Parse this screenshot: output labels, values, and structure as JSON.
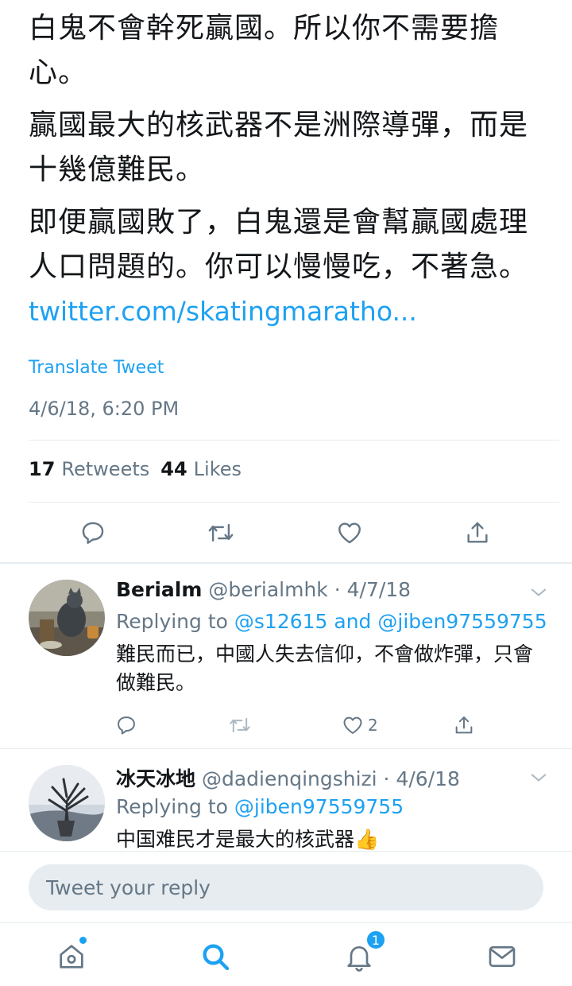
{
  "tweet": {
    "p1": "白鬼不會幹死贏國。所以你不需要擔心。",
    "p2": "贏國最大的核武器不是洲際導彈，而是十幾億難民。",
    "p3": "即便贏國敗了，白鬼還是會幫贏國處理人口問題的。你可以慢慢吃，不著急。",
    "link": "twitter.com/skatingmaratho...",
    "translate": "Translate Tweet",
    "timestamp": "4/6/18, 6:20 PM",
    "retweets_count": "17",
    "retweets_label": "Retweets",
    "likes_count": "44",
    "likes_label": "Likes"
  },
  "replies": [
    {
      "name": "Berialm",
      "handle_date": "@berialmhk · 4/7/18",
      "replying_prefix": "Replying to ",
      "mentions": "@s12615 and @jiben97559755",
      "text": "難民而已，中國人失去信仰，不會做炸彈，只會做難民。",
      "like_count": "2"
    },
    {
      "name": "冰天冰地",
      "handle_date": "@dadienqingshizi · 4/6/18",
      "replying_prefix": "Replying to ",
      "mentions": "@jiben97559755",
      "text": "中国难民才是最大的核武器👍"
    }
  ],
  "composer": {
    "placeholder": "Tweet your reply"
  },
  "tabbar": {
    "notifications_badge": "1"
  },
  "colors": {
    "accent": "#1da1f2",
    "secondary_text": "#657786",
    "divider": "#e6ecf0"
  },
  "icons": [
    "reply-icon",
    "retweet-icon",
    "like-icon",
    "share-icon",
    "chevron-down-icon",
    "home-icon",
    "search-icon",
    "notifications-icon",
    "messages-icon"
  ]
}
